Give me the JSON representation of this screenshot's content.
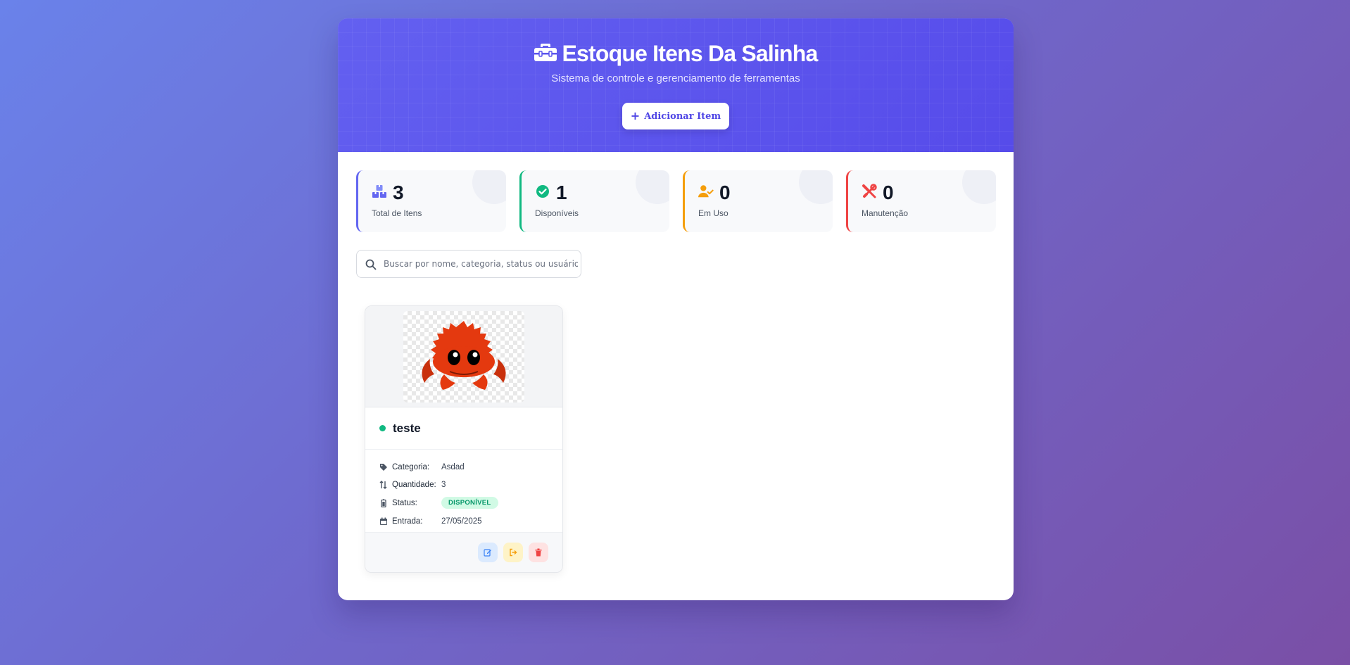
{
  "header": {
    "title": "Estoque Itens Da Salinha",
    "subtitle": "Sistema de controle e gerenciamento de ferramentas",
    "add_button_label": "Adicionar Item"
  },
  "stats": [
    {
      "value": "3",
      "label": "Total de Itens",
      "icon": "boxes-icon",
      "color": "#6366f1"
    },
    {
      "value": "1",
      "label": "Disponíveis",
      "icon": "check-circle-icon",
      "color": "#10b981"
    },
    {
      "value": "0",
      "label": "Em Uso",
      "icon": "user-check-icon",
      "color": "#f59e0b"
    },
    {
      "value": "0",
      "label": "Manutenção",
      "icon": "tools-icon",
      "color": "#ef4444"
    }
  ],
  "search": {
    "placeholder": "Buscar por nome, categoria, status ou usuário..."
  },
  "items": [
    {
      "name": "teste",
      "image": "rust-crab-ferris",
      "status_color": "#10b981",
      "category_label": "Categoria:",
      "category": "Asdad",
      "quantity_label": "Quantidade:",
      "quantity": "3",
      "status_label": "Status:",
      "status": "DISPONÍVEL",
      "entry_label": "Entrada:",
      "entry": "27/05/2025",
      "actions": [
        "edit-icon",
        "checkout-icon",
        "trash-icon"
      ]
    }
  ]
}
